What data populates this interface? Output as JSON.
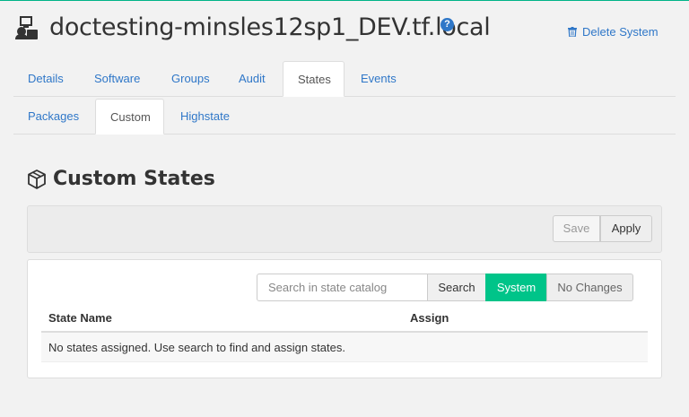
{
  "header": {
    "title": "doctesting-minsles12sp1_DEV.tf.local",
    "help_icon": "?",
    "delete_label": "Delete System",
    "system_icon": "system-icon"
  },
  "main_tabs": [
    {
      "label": "Details",
      "active": false
    },
    {
      "label": "Software",
      "active": false
    },
    {
      "label": "Groups",
      "active": false
    },
    {
      "label": "Audit",
      "active": false
    },
    {
      "label": "States",
      "active": true
    },
    {
      "label": "Events",
      "active": false
    }
  ],
  "sub_tabs": [
    {
      "label": "Packages",
      "active": false
    },
    {
      "label": "Custom",
      "active": true
    },
    {
      "label": "Highstate",
      "active": false
    }
  ],
  "section": {
    "title": "Custom States",
    "icon": "cube-icon"
  },
  "toolbar": {
    "save_label": "Save",
    "apply_label": "Apply"
  },
  "search": {
    "placeholder": "Search in state catalog",
    "value": "",
    "search_label": "Search",
    "system_label": "System",
    "no_changes_label": "No Changes"
  },
  "table": {
    "columns": [
      "State Name",
      "Assign"
    ],
    "empty_message": "No states assigned. Use search to find and assign states."
  },
  "colors": {
    "accent": "#00c489",
    "link": "#2f77c8",
    "top_border": "#00b388"
  }
}
